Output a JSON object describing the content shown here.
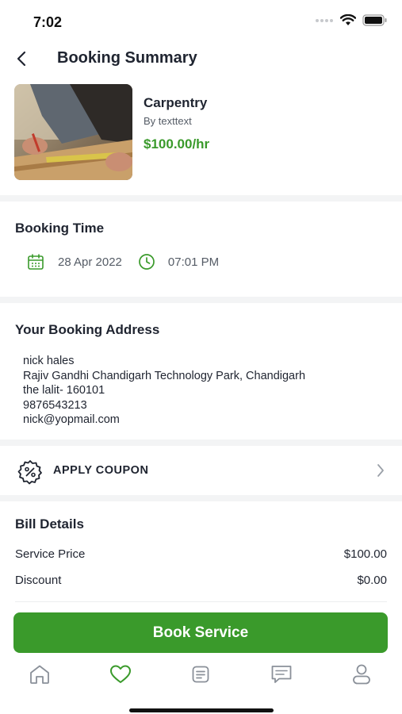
{
  "status_bar": {
    "time": "7:02"
  },
  "header": {
    "title": "Booking Summary"
  },
  "service": {
    "name": "Carpentry",
    "by": "By texttext",
    "price": "$100.00/hr",
    "image_icon": "carpentry-photo"
  },
  "booking_time": {
    "title": "Booking Time",
    "date": "28 Apr 2022",
    "time": "07:01 PM"
  },
  "address": {
    "title": "Your Booking Address",
    "name": "nick hales",
    "line1": "Rajiv Gandhi Chandigarh Technology Park, Chandigarh",
    "line2": "the lalit- 160101",
    "phone": "9876543213",
    "email": "nick@yopmail.com"
  },
  "coupon": {
    "label": "APPLY COUPON"
  },
  "bill": {
    "title": "Bill Details",
    "rows": [
      {
        "label": "Service Price",
        "value": "$100.00"
      },
      {
        "label": "Discount",
        "value": "$0.00"
      }
    ]
  },
  "cta": {
    "label": "Book Service"
  },
  "tabs": [
    {
      "icon": "home-icon",
      "active": false
    },
    {
      "icon": "heart-icon",
      "active": true
    },
    {
      "icon": "bookings-icon",
      "active": false
    },
    {
      "icon": "chat-icon",
      "active": false
    },
    {
      "icon": "profile-icon",
      "active": false
    }
  ],
  "colors": {
    "accent": "#3a9a2b",
    "text": "#1f2430",
    "muted": "#555c66",
    "icon_gray": "#8a9099"
  }
}
